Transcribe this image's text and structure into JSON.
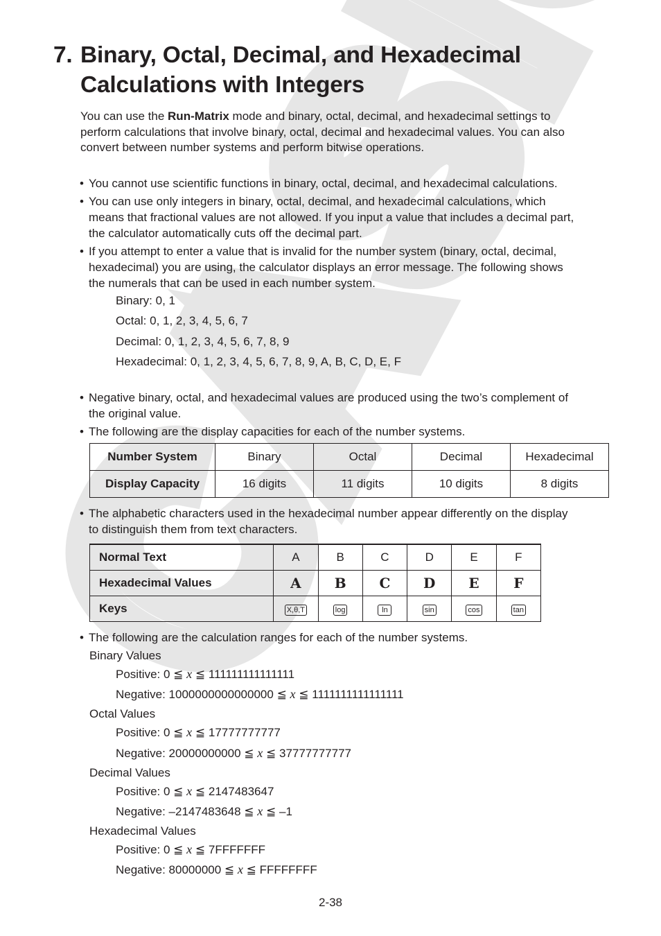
{
  "watermark": "CASIO",
  "heading": {
    "number": "7.",
    "line1": "Binary, Octal, Decimal, and Hexadecimal",
    "line2": "Calculations with Integers"
  },
  "intro": {
    "pre": "You can use the ",
    "bold": "Run-Matrix",
    "line1_post": " mode and binary, octal, decimal, and hexadecimal settings to",
    "line2": "perform calculations that involve binary, octal, decimal and hexadecimal values. You can also",
    "line3": "convert between number systems and perform bitwise operations."
  },
  "bullets": {
    "b1": [
      "You cannot use scientific functions in binary, octal, decimal, and hexadecimal calculations."
    ],
    "b2": [
      "You can use only integers in binary, octal, decimal, and hexadecimal calculations, which",
      "means that fractional values are not allowed. If you input a value that includes a decimal part,",
      "the calculator automatically cuts off the decimal part."
    ],
    "b3": [
      "If you attempt to enter a value that is invalid for the number system (binary, octal, decimal,",
      "hexadecimal) you are using, the calculator displays an error message. The following shows",
      "the numerals that can be used in each number system."
    ],
    "numerals": [
      "Binary: 0, 1",
      "Octal: 0, 1, 2, 3, 4, 5, 6, 7",
      "Decimal: 0, 1, 2, 3, 4, 5, 6, 7, 8, 9",
      "Hexadecimal: 0, 1, 2, 3, 4, 5, 6, 7, 8, 9, A, B, C, D, E, F"
    ],
    "b4": [
      "Negative binary, octal, and hexadecimal values are produced using the two’s complement of",
      "the original value."
    ],
    "b5": [
      "The following are the display capacities for each of the number systems."
    ],
    "b6": [
      "The alphabetic characters used in the hexadecimal number appear differently on the display",
      "to distinguish them from text characters."
    ],
    "b7": [
      "The following are the calculation ranges for each of the number systems."
    ],
    "dot": "•"
  },
  "capacity_table": {
    "row_headers": [
      "Number System",
      "Display Capacity"
    ],
    "systems": [
      "Binary",
      "Octal",
      "Decimal",
      "Hexadecimal"
    ],
    "capacities": [
      "16 digits",
      "11 digits",
      "10 digits",
      "8 digits"
    ]
  },
  "hex_table": {
    "row_headers": [
      "Normal Text",
      "Hexadecimal Values",
      "Keys"
    ],
    "normal": [
      "A",
      "B",
      "C",
      "D",
      "E",
      "F"
    ],
    "hexvals": [
      "A",
      "B",
      "C",
      "D",
      "E",
      "F"
    ],
    "keys": [
      "X,θ,T",
      "log",
      "ln",
      "sin",
      "cos",
      "tan"
    ]
  },
  "ranges": {
    "leq": "≦",
    "var": "x",
    "groups": [
      {
        "label": "Binary Values",
        "pos_pre": "Positive: 0",
        "pos_post": "111111111111111",
        "neg_pre": "Negative: 1000000000000000",
        "neg_post": "1111111111111111"
      },
      {
        "label": "Octal Values",
        "pos_pre": "Positive: 0",
        "pos_post": "17777777777",
        "neg_pre": "Negative: 20000000000",
        "neg_post": "37777777777"
      },
      {
        "label": "Decimal Values",
        "pos_pre": "Positive: 0",
        "pos_post": "2147483647",
        "neg_pre": "Negative: –2147483648",
        "neg_post": "–1"
      },
      {
        "label": "Hexadecimal Values",
        "pos_pre": "Positive: 0",
        "pos_post": "7FFFFFFF",
        "neg_pre": "Negative: 80000000",
        "neg_post": "FFFFFFFF"
      }
    ]
  },
  "footer": {
    "page_number": "2-38"
  }
}
